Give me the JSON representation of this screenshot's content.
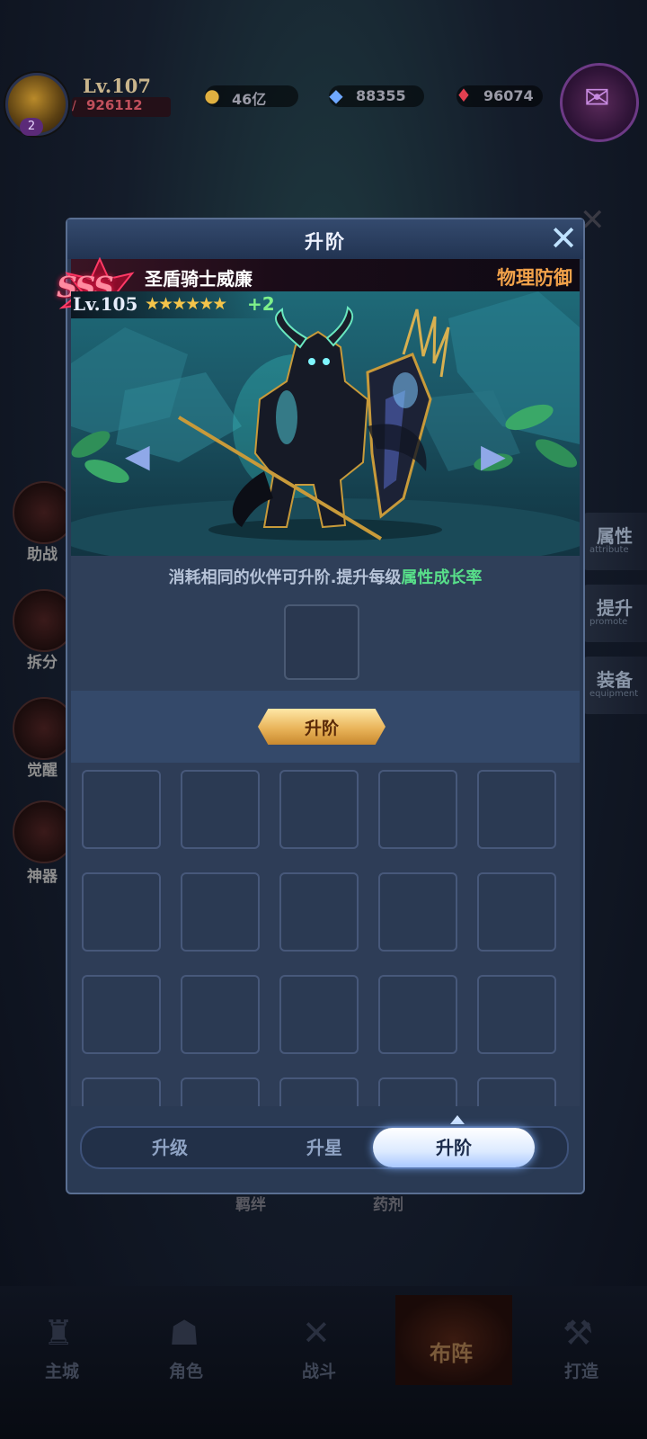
{
  "header": {
    "level": "Lv.107",
    "power": "926112",
    "avatar_badge": "2",
    "resources": [
      {
        "name": "gold",
        "icon": "coin-icon",
        "value": "46亿",
        "color": "#e0b040"
      },
      {
        "name": "diamond",
        "icon": "diamond-icon",
        "value": "88355",
        "color": "#6fa8ff"
      },
      {
        "name": "ruby",
        "icon": "ruby-icon",
        "value": "96074",
        "color": "#e04050"
      }
    ]
  },
  "background": {
    "left_menu": [
      "助战",
      "拆分",
      "觉醒",
      "神器"
    ],
    "right_menu": [
      {
        "label": "属性",
        "sub": "attribute"
      },
      {
        "label": "提升",
        "sub": "promote"
      },
      {
        "label": "装备",
        "sub": "equipment"
      }
    ],
    "bottom_nav": [
      "主城",
      "角色",
      "战斗",
      "布阵",
      "打造"
    ],
    "behind_labels": [
      "羁绊",
      "药剂"
    ]
  },
  "panel": {
    "title": "升阶",
    "close_icon": "close-icon",
    "hero": {
      "rank": "SSS",
      "name": "圣盾骑士威廉",
      "type": "物理防御",
      "level": "Lv.105",
      "stars": "★★★★★★",
      "star_count": 6,
      "star_bonus": "+2"
    },
    "description_prefix": "消耗相同的伙伴可升阶.提升每级",
    "description_highlight": "属性成长率",
    "ascend_button": "升阶",
    "grid": {
      "columns": 5,
      "visible_rows": 4
    },
    "tabs": [
      {
        "label": "升级",
        "active": false
      },
      {
        "label": "升星",
        "active": false
      },
      {
        "label": "升阶",
        "active": true
      }
    ]
  },
  "colors": {
    "accent_gold": "#e9b45a",
    "highlight_green": "#58e08a",
    "hero_type_orange": "#f2a24a",
    "panel_bg": "#2a3a54"
  }
}
